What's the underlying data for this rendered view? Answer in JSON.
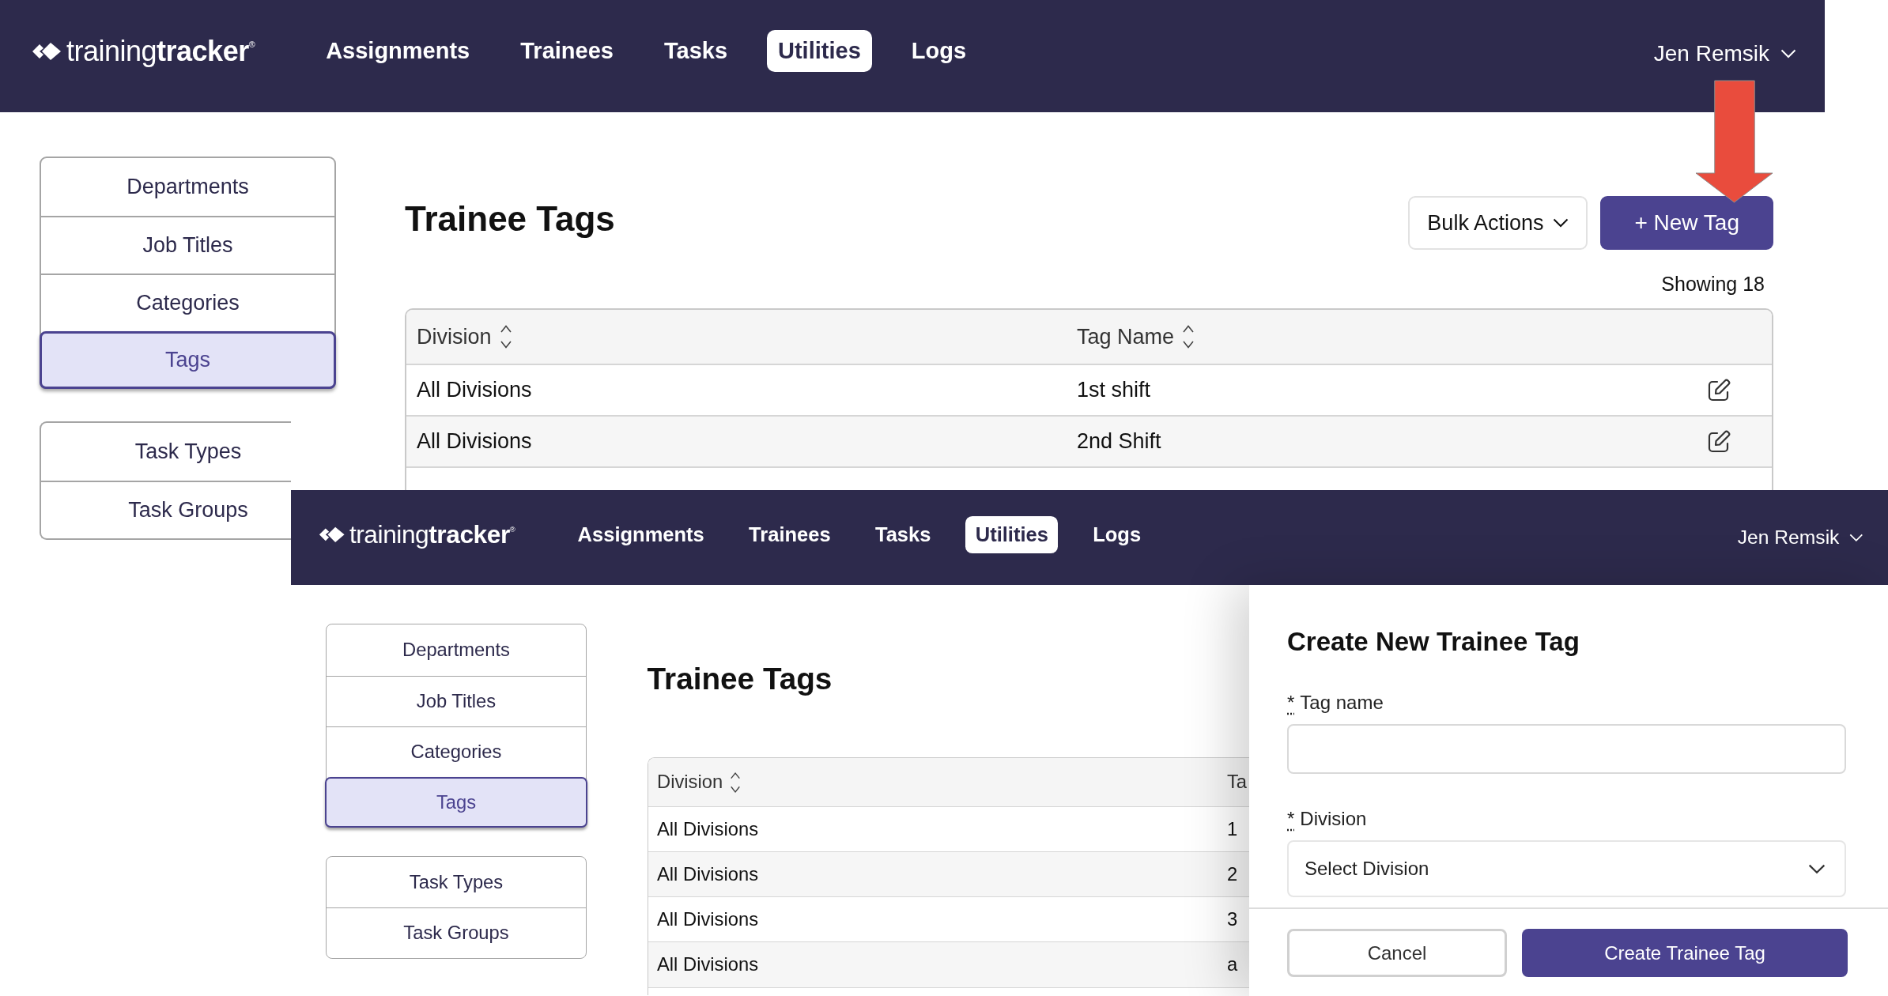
{
  "screens": [
    {
      "nav": {
        "logo": "training**tracker**$^{®}$",
        "items": [
          {
            "label": "Assignments",
            "selected": false
          },
          {
            "label": "Trainees",
            "selected": false
          },
          {
            "label": "Tasks",
            "selected": false
          },
          {
            "label": "Utilities",
            "selected": true
          },
          {
            "label": "Logs",
            "selected": false
          }
        ],
        "user": "Jen Remsik"
      },
      "sidebar": {
        "groups": [
          {
            "items": [
              {
                "label": "Departments",
                "selected": false
              },
              {
                "label": "Job Titles",
                "selected": false
              },
              {
                "label": "Categories",
                "selected": false
              },
              {
                "label": "Tags",
                "selected": true
              }
            ]
          },
          {
            "items": [
              {
                "label": "Task Types",
                "selected": false
              },
              {
                "label": "Task Groups",
                "selected": false
              }
            ]
          }
        ]
      },
      "page": {
        "title": "Trainee Tags",
        "actions": [
          {
            "kind": "dropdown",
            "label": "Bulk Actions"
          },
          {
            "kind": "primary",
            "label": "+ New Tag"
          }
        ],
        "count": "Showing 18",
        "table": {
          "columns": [
            {
              "label": "Division",
              "sortable": true
            },
            {
              "label": "Tag Name",
              "sortable": true
            }
          ],
          "rows": [
            {
              "cells": [
                "All Divisions",
                "1st shift"
              ],
              "editable": true
            },
            {
              "cells": [
                "All Divisions",
                "2nd Shift"
              ],
              "editable": true
            }
          ]
        }
      }
    },
    {
      "nav": {
        "logo": "training**tracker**$^{®}$",
        "items": [
          {
            "label": "Assignments",
            "selected": false
          },
          {
            "label": "Trainees",
            "selected": false
          },
          {
            "label": "Tasks",
            "selected": false
          },
          {
            "label": "Utilities",
            "selected": true
          },
          {
            "label": "Logs",
            "selected": false
          }
        ],
        "user": "Jen Remsik"
      },
      "sidebar": {
        "groups": [
          {
            "items": [
              {
                "label": "Departments",
                "selected": false
              },
              {
                "label": "Job Titles",
                "selected": false
              },
              {
                "label": "Categories",
                "selected": false
              },
              {
                "label": "Tags",
                "selected": true
              }
            ]
          },
          {
            "items": [
              {
                "label": "Task Types",
                "selected": false
              },
              {
                "label": "Task Groups",
                "selected": false
              }
            ]
          }
        ]
      },
      "page": {
        "title": "Trainee Tags",
        "table": {
          "columns": [
            {
              "label": "Division",
              "sortable": true
            },
            {
              "label": "Ta"
            }
          ],
          "rows": [
            {
              "cells": [
                "All Divisions",
                "1"
              ]
            },
            {
              "cells": [
                "All Divisions",
                "2"
              ]
            },
            {
              "cells": [
                "All Divisions",
                "3"
              ]
            },
            {
              "cells": [
                "All Divisions",
                "a"
              ]
            }
          ]
        }
      },
      "drawer": {
        "title": "Create New Trainee Tag",
        "fields": [
          {
            "kind": "text",
            "required_mark": "*",
            "label": "Tag name"
          },
          {
            "kind": "select",
            "required_mark": "*",
            "label": "Division",
            "value": "Select Division"
          }
        ],
        "buttons": [
          {
            "kind": "secondary",
            "label": "Cancel"
          },
          {
            "kind": "primary",
            "label": "Create Trainee Tag"
          }
        ]
      }
    }
  ]
}
